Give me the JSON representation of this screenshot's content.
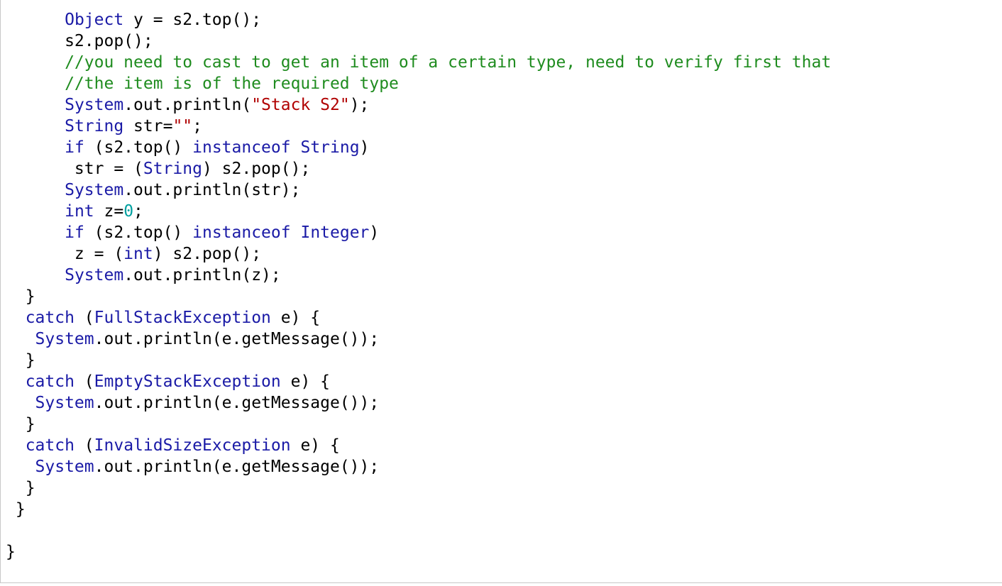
{
  "editor": {
    "lines": [
      [
        {
          "t": "      "
        },
        {
          "t": "Object",
          "c": "kw"
        },
        {
          "t": " y = s2.top();"
        }
      ],
      [
        {
          "t": "      s2.pop();"
        }
      ],
      [
        {
          "t": "      //you need to cast to get an item of a certain type, need to verify first that",
          "c": "com"
        }
      ],
      [
        {
          "t": "      //the item is of the required type",
          "c": "com"
        }
      ],
      [
        {
          "t": "      "
        },
        {
          "t": "System",
          "c": "kw"
        },
        {
          "t": ".out.println("
        },
        {
          "t": "\"Stack S2\"",
          "c": "str"
        },
        {
          "t": ");"
        }
      ],
      [
        {
          "t": "      "
        },
        {
          "t": "String",
          "c": "kw"
        },
        {
          "t": " str="
        },
        {
          "t": "\"\"",
          "c": "str"
        },
        {
          "t": ";"
        }
      ],
      [
        {
          "t": "      "
        },
        {
          "t": "if",
          "c": "kw"
        },
        {
          "t": " (s2.top() "
        },
        {
          "t": "instanceof",
          "c": "kw"
        },
        {
          "t": " "
        },
        {
          "t": "String",
          "c": "kw"
        },
        {
          "t": ")"
        }
      ],
      [
        {
          "t": "       str = ("
        },
        {
          "t": "String",
          "c": "kw"
        },
        {
          "t": ") s2.pop();"
        }
      ],
      [
        {
          "t": "      "
        },
        {
          "t": "System",
          "c": "kw"
        },
        {
          "t": ".out.println(str);"
        }
      ],
      [
        {
          "t": "      "
        },
        {
          "t": "int",
          "c": "kw"
        },
        {
          "t": " z="
        },
        {
          "t": "0",
          "c": "num"
        },
        {
          "t": ";"
        }
      ],
      [
        {
          "t": "      "
        },
        {
          "t": "if",
          "c": "kw"
        },
        {
          "t": " (s2.top() "
        },
        {
          "t": "instanceof",
          "c": "kw"
        },
        {
          "t": " "
        },
        {
          "t": "Integer",
          "c": "kw"
        },
        {
          "t": ")"
        }
      ],
      [
        {
          "t": "       z = ("
        },
        {
          "t": "int",
          "c": "kw"
        },
        {
          "t": ") s2.pop();"
        }
      ],
      [
        {
          "t": "      "
        },
        {
          "t": "System",
          "c": "kw"
        },
        {
          "t": ".out.println(z);"
        }
      ],
      [
        {
          "t": "  }"
        }
      ],
      [
        {
          "t": "  "
        },
        {
          "t": "catch",
          "c": "kw"
        },
        {
          "t": " ("
        },
        {
          "t": "FullStackException",
          "c": "kw"
        },
        {
          "t": " e) {"
        }
      ],
      [
        {
          "t": "   "
        },
        {
          "t": "System",
          "c": "kw"
        },
        {
          "t": ".out.println(e.getMessage());"
        }
      ],
      [
        {
          "t": "  }"
        }
      ],
      [
        {
          "t": "  "
        },
        {
          "t": "catch",
          "c": "kw"
        },
        {
          "t": " ("
        },
        {
          "t": "EmptyStackException",
          "c": "kw"
        },
        {
          "t": " e) {"
        }
      ],
      [
        {
          "t": "   "
        },
        {
          "t": "System",
          "c": "kw"
        },
        {
          "t": ".out.println(e.getMessage());"
        }
      ],
      [
        {
          "t": "  }"
        }
      ],
      [
        {
          "t": "  "
        },
        {
          "t": "catch",
          "c": "kw"
        },
        {
          "t": " ("
        },
        {
          "t": "InvalidSizeException",
          "c": "kw"
        },
        {
          "t": " e) {"
        }
      ],
      [
        {
          "t": "   "
        },
        {
          "t": "System",
          "c": "kw"
        },
        {
          "t": ".out.println(e.getMessage());"
        }
      ],
      [
        {
          "t": "  }"
        }
      ],
      [
        {
          "t": " }"
        }
      ],
      [
        {
          "t": ""
        }
      ],
      [
        {
          "t": "}"
        }
      ]
    ]
  },
  "colors": {
    "keyword": "#1a1aa6",
    "comment": "#1f8c1f",
    "string": "#b00000",
    "number": "#00a0a0",
    "text": "#000000",
    "background": "#ffffff"
  }
}
